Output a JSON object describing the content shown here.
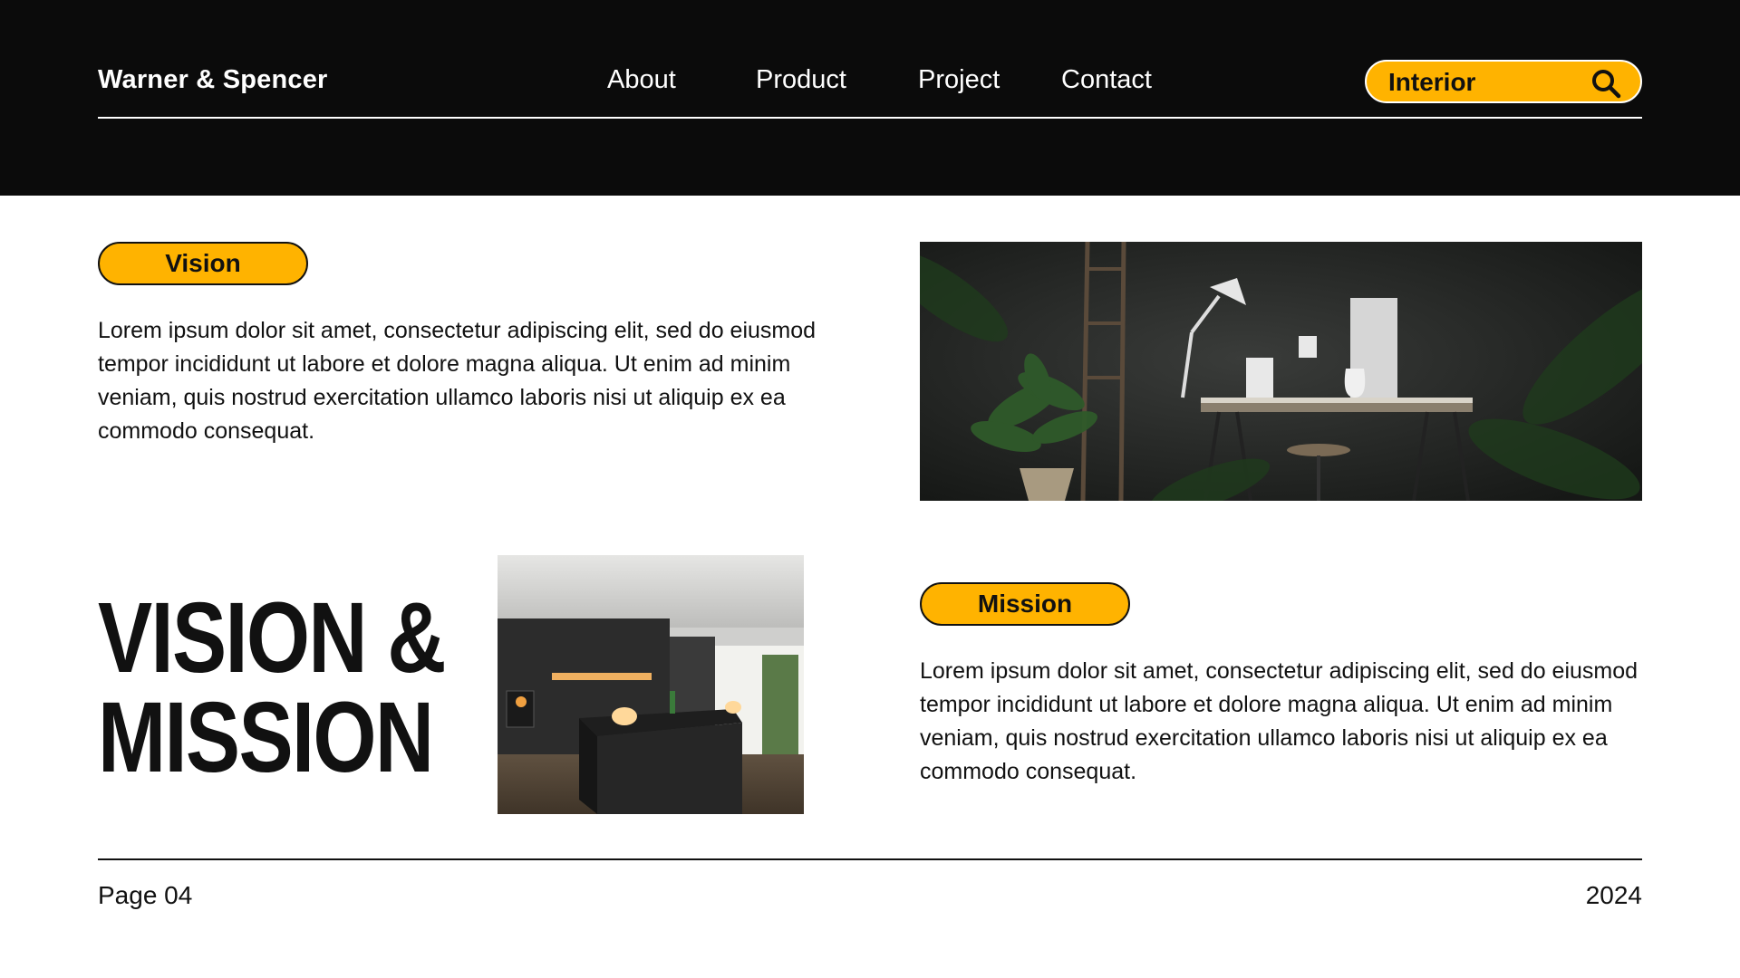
{
  "header": {
    "brand": "Warner & Spencer",
    "nav": [
      "About",
      "Product",
      "Project",
      "Contact"
    ],
    "search": {
      "value": "Interior",
      "icon": "search-icon"
    }
  },
  "vision": {
    "label": "Vision",
    "body": "Lorem ipsum dolor sit amet, consectetur adipiscing elit, sed do eiusmod tempor incididunt ut labore et dolore magna aliqua. Ut enim ad minim veniam, quis nostrud exercitation ullamco laboris nisi ut aliquip ex ea commodo consequat."
  },
  "mission": {
    "label": "Mission",
    "body": "Lorem ipsum dolor sit amet, consectetur adipiscing elit, sed do eiusmod tempor incididunt ut labore et dolore magna aliqua. Ut enim ad minim veniam, quis nostrud exercitation ullamco laboris nisi ut aliquip ex ea commodo consequat."
  },
  "title": {
    "line1": "VISION &",
    "line2": "MISSION"
  },
  "footer": {
    "page": "Page 04",
    "year": "2024"
  },
  "colors": {
    "accent": "#ffb300",
    "header_bg": "#0b0b0b",
    "text": "#111111"
  }
}
